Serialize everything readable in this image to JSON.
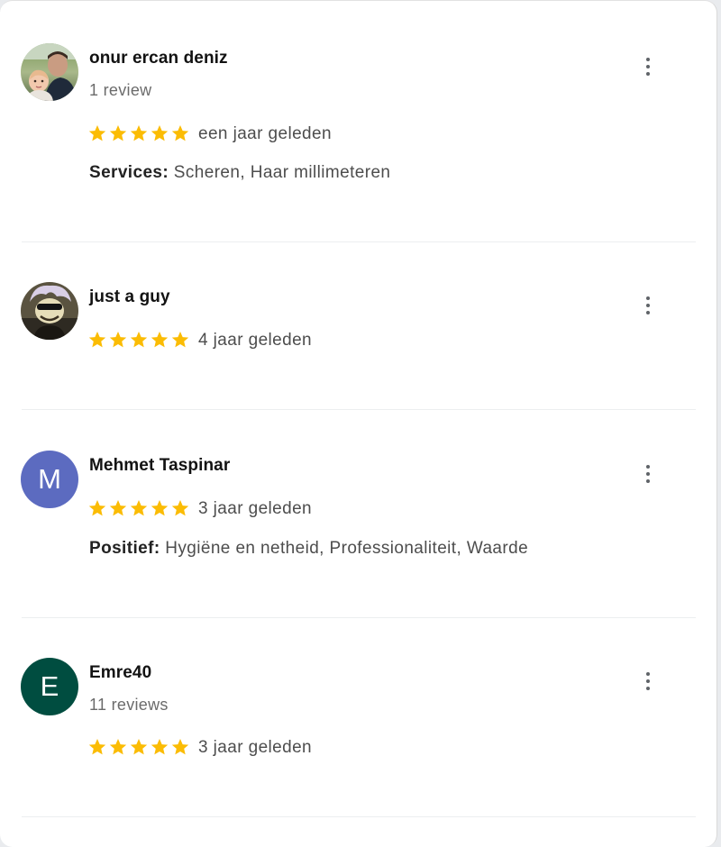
{
  "reviews": [
    {
      "name": "onur ercan deniz",
      "review_count": "1 review",
      "rating": 5,
      "date": "een jaar geleden",
      "attribute_label": "Services:",
      "attribute_value": "Scheren, Haar millimeteren",
      "avatar_type": "photo-person-with-baby"
    },
    {
      "name": "just a guy",
      "rating": 5,
      "date": "4 jaar geleden",
      "avatar_type": "photo-cartoon-character"
    },
    {
      "name": "Mehmet Taspinar",
      "avatar_letter": "M",
      "avatar_color": "#5c6bc0",
      "rating": 5,
      "date": "3 jaar geleden",
      "attribute_label": "Positief:",
      "attribute_value": "Hygiëne en netheid, Professionaliteit, Waarde"
    },
    {
      "name": "Emre40",
      "avatar_letter": "E",
      "avatar_color": "#004d40",
      "review_count": "11 reviews",
      "rating": 5,
      "date": "3 jaar geleden"
    }
  ],
  "colors": {
    "star": "#fbbc04",
    "menu_dots": "#5f6368"
  },
  "icons": {
    "star": "star-icon",
    "menu": "more-vert-icon"
  }
}
